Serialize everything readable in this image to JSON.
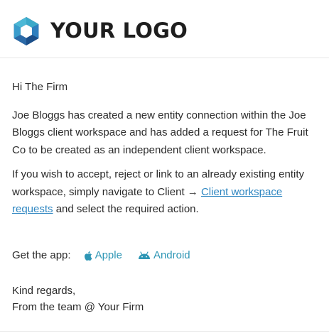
{
  "header": {
    "logo_text": "YOUR LOGO",
    "logo_icon": "hexagon-aperture-logo-icon",
    "logo_colors": [
      "#1b4f8a",
      "#2e7fbf",
      "#3aa9c9",
      "#1d3b6e"
    ]
  },
  "email": {
    "greeting": "Hi The Firm",
    "paragraph1": "Joe Bloggs has created a new entity connection within the Joe Bloggs client workspace and has added a request for The Fruit Co to be created as an independent client workspace.",
    "paragraph2_before": "If you wish to accept, reject or link to an already existing entity workspace, simply navigate to Client → ",
    "paragraph2_link": "Client workspace requests",
    "paragraph2_after": " and select the required action.",
    "get_app_label": "Get the app:",
    "apple_label": "Apple",
    "apple_icon": "apple-icon",
    "android_label": "Android",
    "android_icon": "android-icon",
    "signoff_line1": "Kind regards,",
    "signoff_line2": "From the team @ Your Firm"
  },
  "colors": {
    "link": "#2e86c1",
    "app_link": "#2e96b5",
    "text": "#2b2b2b",
    "divider": "#e6e6e6"
  }
}
